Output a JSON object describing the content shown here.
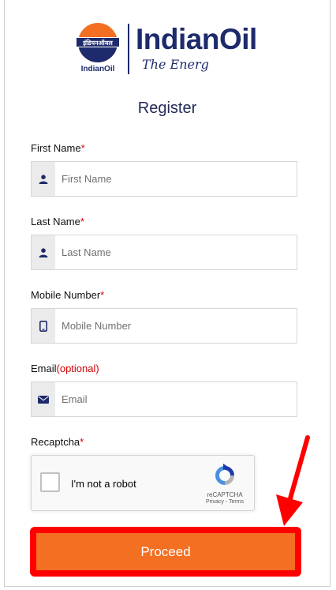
{
  "brand": {
    "name": "IndianOil",
    "tagline": "The Energ",
    "logo_caption": "IndianOil",
    "logo_hindi": "इंडियनऑयल",
    "colors": {
      "navy": "#1d2a6b",
      "orange": "#f36f21"
    }
  },
  "page": {
    "title": "Register"
  },
  "form": {
    "first_name": {
      "label": "First Name",
      "required_mark": "*",
      "placeholder": "First Name",
      "value": "",
      "icon": "user-icon"
    },
    "last_name": {
      "label": "Last Name",
      "required_mark": "*",
      "placeholder": "Last Name",
      "value": "",
      "icon": "user-icon"
    },
    "mobile": {
      "label": "Mobile Number",
      "required_mark": "*",
      "placeholder": "Mobile Number",
      "value": "",
      "icon": "mobile-phone-icon"
    },
    "email": {
      "label": "Email",
      "optional_note": "(optional)",
      "placeholder": "Email",
      "value": "",
      "icon": "envelope-icon"
    },
    "recaptcha": {
      "label": "Recaptcha",
      "required_mark": "*",
      "checkbox_text": "I'm not a robot",
      "brand": "reCAPTCHA",
      "links": "Privacy - Terms"
    },
    "submit_label": "Proceed"
  },
  "annotation": {
    "highlight_color": "#ff0000"
  }
}
